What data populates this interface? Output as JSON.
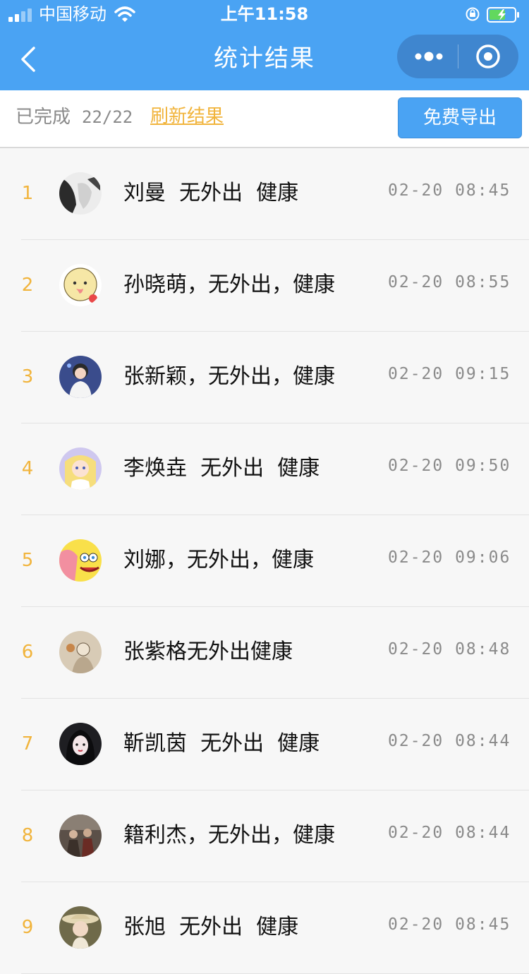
{
  "status_bar": {
    "carrier": "中国移动",
    "time": "上午11:58"
  },
  "nav": {
    "title": "统计结果"
  },
  "toolbar": {
    "done_label": "已完成",
    "done_count": "22/22",
    "refresh_label": "刷新结果",
    "export_label": "免费导出"
  },
  "list": {
    "items": [
      {
        "index": "1",
        "text": "刘曼  无外出  健康",
        "time": "02-20 08:45"
      },
      {
        "index": "2",
        "text": "孙晓萌，无外出，健康",
        "time": "02-20 08:55"
      },
      {
        "index": "3",
        "text": "张新颖，无外出，健康",
        "time": "02-20 09:15"
      },
      {
        "index": "4",
        "text": "李焕垚  无外出  健康",
        "time": "02-20 09:50"
      },
      {
        "index": "5",
        "text": "刘娜，无外出，健康",
        "time": "02-20 09:06"
      },
      {
        "index": "6",
        "text": "张紫格无外出健康",
        "time": "02-20 08:48"
      },
      {
        "index": "7",
        "text": "靳凯茵  无外出  健康",
        "time": "02-20 08:44"
      },
      {
        "index": "8",
        "text": "籍利杰，无外出，健康",
        "time": "02-20 08:44"
      },
      {
        "index": "9",
        "text": "张旭  无外出  健康",
        "time": "02-20 08:45"
      }
    ]
  },
  "colors": {
    "header_bg": "#4aa3f3",
    "accent_orange": "#f1b43c",
    "text_gray": "#8a8a8a"
  },
  "icons": {
    "back": "chevron-left-icon",
    "more": "more-dots-icon",
    "close": "target-circle-icon"
  }
}
